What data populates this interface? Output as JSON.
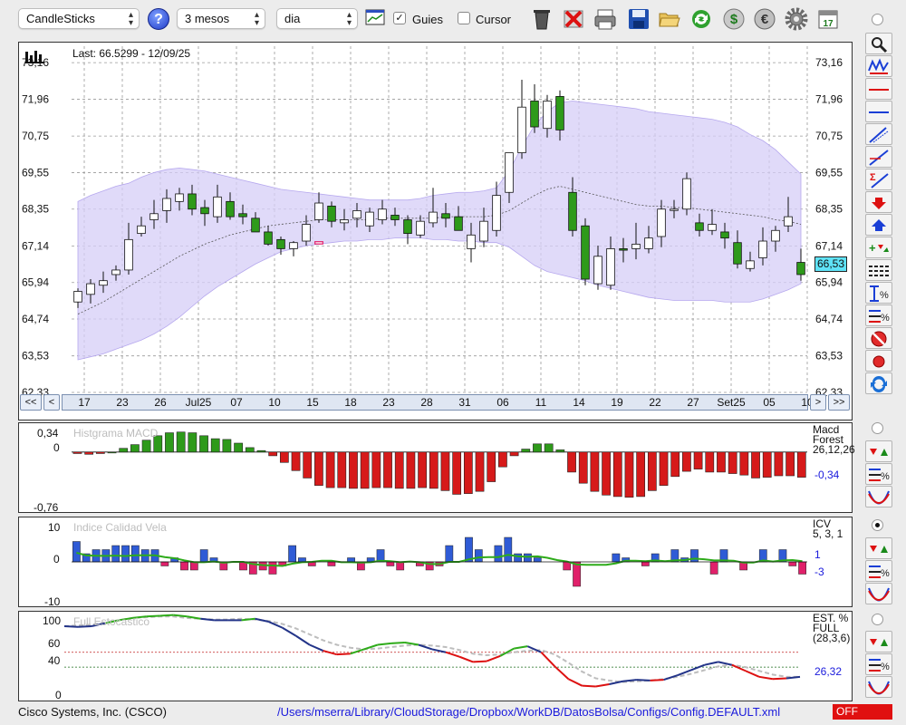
{
  "toolbar": {
    "chart_type": "CandleSticks",
    "period": "3 mesos",
    "interval": "dia",
    "guides_label": "Guies",
    "guides_checked": true,
    "cursor_label": "Cursor",
    "cursor_checked": false
  },
  "price_panel": {
    "last_label": "Last: 66.5299 - 12/09/25",
    "current_price": "66,53",
    "y_ticks": [
      "73,16",
      "71,96",
      "70,75",
      "69,55",
      "68,35",
      "67,14",
      "65,94",
      "64,74",
      "63,53",
      "62,33"
    ],
    "x_ticks": [
      "17",
      "23",
      "26",
      "Jul25",
      "07",
      "10",
      "15",
      "18",
      "23",
      "28",
      "31",
      "06",
      "11",
      "14",
      "19",
      "22",
      "27",
      "Set25",
      "05",
      "10"
    ],
    "nav": {
      "first": "<<",
      "prev": "<",
      "next": ">",
      "last": ">>"
    }
  },
  "macd_panel": {
    "title": "Histgrama MACD",
    "y_ticks": [
      "0,34",
      "0",
      "-0,76"
    ],
    "name": "Macd",
    "sub": "Forest",
    "params": "26,12,26",
    "value": "-0,34"
  },
  "icv_panel": {
    "title": "Indice Calidad Vela",
    "y_ticks": [
      "10",
      "0",
      "-10"
    ],
    "name": "ICV",
    "params": "5, 3, 1",
    "value1": "1",
    "value2": "-3"
  },
  "stoch_panel": {
    "title": "Full Estocastico",
    "y_ticks": [
      "100",
      "60",
      "40",
      "0"
    ],
    "name": "EST. %",
    "sub": "FULL",
    "params": "(28,3,6)",
    "value": "26,32"
  },
  "status": {
    "symbol": "Cisco Systems, Inc. (CSCO)",
    "config_path": "/Users/mserra/Library/CloudStorage/Dropbox/WorkDB/DatosBolsa/Configs/Config.DEFAULT.xml",
    "mode": "OFF"
  },
  "colors": {
    "up": "#2e9a1a",
    "down": "#d61a1a",
    "band": "#d6cdf7",
    "cyan": "#5fe3f7"
  },
  "chart_data": [
    {
      "type": "candlestick",
      "title": "",
      "ylim": [
        62.33,
        73.7
      ],
      "open": [
        65.3,
        65.55,
        65.85,
        66.2,
        66.35,
        67.55,
        68.0,
        68.3,
        68.6,
        68.85,
        68.4,
        68.1,
        68.6,
        68.2,
        68.05,
        67.6,
        67.35,
        67.05,
        67.3,
        68.0,
        68.45,
        67.9,
        68.05,
        67.8,
        68.0,
        68.15,
        68.0,
        67.5,
        67.9,
        68.2,
        68.1,
        67.05,
        67.3,
        67.65,
        68.9,
        70.2,
        71.9,
        71.0,
        72.05,
        68.9,
        67.8,
        65.9,
        65.85,
        67.05,
        67.05,
        67.05,
        67.45,
        68.35,
        68.35,
        67.9,
        67.65,
        67.6,
        67.25,
        66.4,
        66.75,
        67.3,
        67.8,
        66.6
      ],
      "close": [
        65.65,
        65.9,
        66.0,
        66.35,
        67.35,
        67.8,
        68.2,
        68.7,
        68.85,
        68.35,
        68.2,
        68.75,
        68.1,
        68.1,
        67.6,
        67.2,
        67.05,
        67.25,
        67.85,
        68.55,
        67.95,
        68.0,
        68.3,
        68.25,
        68.35,
        68.0,
        67.55,
        67.95,
        68.25,
        68.05,
        67.65,
        67.5,
        67.95,
        68.8,
        70.2,
        71.7,
        71.05,
        71.9,
        70.95,
        67.65,
        66.05,
        66.8,
        67.05,
        67.0,
        67.2,
        67.4,
        68.35,
        68.35,
        69.35,
        67.65,
        67.85,
        67.4,
        66.55,
        66.65,
        67.3,
        67.65,
        68.1,
        66.2
      ],
      "high": [
        65.75,
        66.05,
        66.3,
        66.5,
        67.9,
        68.1,
        68.65,
        69.0,
        69.05,
        69.15,
        68.65,
        69.15,
        68.9,
        68.5,
        68.25,
        67.8,
        67.45,
        67.3,
        68.15,
        68.9,
        68.6,
        68.35,
        68.55,
        68.4,
        68.65,
        68.4,
        68.15,
        68.15,
        69.05,
        68.55,
        68.45,
        67.9,
        68.4,
        69.25,
        69.95,
        72.6,
        72.45,
        72.1,
        72.25,
        69.4,
        68.05,
        67.15,
        67.45,
        67.4,
        67.9,
        67.8,
        68.65,
        68.65,
        69.55,
        68.2,
        68.35,
        67.9,
        67.65,
        66.95,
        67.75,
        67.8,
        68.75,
        67.05
      ],
      "low": [
        65.1,
        65.25,
        65.6,
        66.0,
        66.2,
        67.45,
        67.7,
        67.9,
        68.3,
        68.15,
        67.8,
        67.9,
        68.0,
        67.85,
        67.6,
        67.15,
        66.85,
        66.8,
        67.15,
        67.9,
        67.75,
        67.65,
        67.75,
        67.6,
        67.85,
        67.8,
        67.2,
        67.4,
        67.75,
        67.75,
        67.7,
        66.6,
        67.1,
        67.45,
        68.55,
        70.0,
        70.85,
        70.7,
        70.6,
        67.45,
        65.85,
        65.7,
        65.7,
        66.6,
        66.7,
        66.9,
        67.1,
        68.05,
        68.15,
        67.45,
        67.5,
        67.05,
        66.4,
        66.3,
        66.5,
        66.95,
        67.6,
        66.0
      ],
      "bollinger_upper": [
        68.6,
        68.8,
        68.95,
        69.1,
        69.2,
        69.4,
        69.55,
        69.65,
        69.7,
        69.65,
        69.6,
        69.5,
        69.4,
        69.3,
        69.2,
        69.1,
        69.0,
        68.95,
        68.9,
        68.85,
        68.8,
        68.75,
        68.7,
        68.65,
        68.65,
        68.65,
        68.65,
        68.7,
        68.8,
        68.85,
        68.9,
        68.9,
        68.95,
        69.05,
        69.6,
        70.4,
        71.1,
        71.55,
        71.85,
        71.9,
        71.85,
        71.8,
        71.75,
        71.7,
        71.65,
        71.55,
        71.5,
        71.45,
        71.4,
        71.35,
        71.3,
        71.2,
        71.05,
        70.8,
        70.6,
        70.3,
        69.9,
        69.5
      ],
      "bollinger_middle": [
        64.9,
        65.1,
        65.3,
        65.55,
        65.8,
        66.05,
        66.3,
        66.55,
        66.8,
        67.0,
        67.2,
        67.35,
        67.5,
        67.6,
        67.7,
        67.8,
        67.85,
        67.9,
        67.95,
        68.0,
        68.0,
        68.0,
        68.0,
        68.0,
        68.05,
        68.05,
        68.05,
        68.05,
        68.05,
        68.1,
        68.1,
        68.1,
        68.1,
        68.15,
        68.3,
        68.55,
        68.8,
        69.0,
        69.1,
        69.0,
        68.9,
        68.8,
        68.7,
        68.6,
        68.5,
        68.45,
        68.45,
        68.4,
        68.4,
        68.35,
        68.3,
        68.25,
        68.2,
        68.15,
        68.1,
        68.0,
        67.95,
        67.85
      ],
      "bollinger_lower": [
        63.4,
        63.5,
        63.6,
        63.75,
        63.9,
        64.05,
        64.25,
        64.5,
        64.8,
        65.15,
        65.5,
        65.8,
        66.05,
        66.3,
        66.55,
        66.75,
        66.95,
        67.05,
        67.15,
        67.2,
        67.25,
        67.3,
        67.3,
        67.35,
        67.35,
        67.4,
        67.4,
        67.4,
        67.35,
        67.35,
        67.3,
        67.3,
        67.25,
        67.25,
        67.1,
        66.8,
        66.5,
        66.3,
        66.2,
        66.1,
        66.0,
        65.85,
        65.75,
        65.65,
        65.55,
        65.45,
        65.4,
        65.35,
        65.35,
        65.35,
        65.35,
        65.3,
        65.3,
        65.3,
        65.4,
        65.55,
        65.7,
        65.9
      ]
    },
    {
      "type": "bar",
      "title": "Histgrama MACD",
      "ylim": [
        -0.76,
        0.34
      ],
      "values": [
        -0.02,
        -0.03,
        -0.02,
        0.0,
        0.05,
        0.1,
        0.16,
        0.22,
        0.26,
        0.27,
        0.26,
        0.22,
        0.18,
        0.17,
        0.12,
        0.06,
        0.02,
        -0.05,
        -0.14,
        -0.25,
        -0.35,
        -0.45,
        -0.48,
        -0.48,
        -0.49,
        -0.49,
        -0.48,
        -0.48,
        -0.49,
        -0.49,
        -0.48,
        -0.49,
        -0.52,
        -0.57,
        -0.56,
        -0.53,
        -0.4,
        -0.2,
        -0.05,
        0.04,
        0.11,
        0.11,
        0.03,
        -0.27,
        -0.42,
        -0.53,
        -0.58,
        -0.6,
        -0.61,
        -0.6,
        -0.52,
        -0.45,
        -0.33,
        -0.26,
        -0.23,
        -0.27,
        -0.27,
        -0.29,
        -0.31,
        -0.35,
        -0.34,
        -0.32,
        -0.32,
        -0.34
      ]
    },
    {
      "type": "bar",
      "title": "Indice Calidad Vela",
      "ylim": [
        -10,
        10
      ],
      "values": [
        5,
        2,
        3,
        3,
        4,
        4,
        4,
        3,
        3,
        -1,
        1,
        -2,
        -2,
        3,
        1,
        -2,
        0,
        -2,
        -3,
        -2,
        -3,
        -1,
        4,
        1,
        -1,
        0,
        -1,
        0,
        1,
        -2,
        1,
        3,
        -1,
        -2,
        0,
        -1,
        -2,
        -1,
        4,
        0,
        6,
        3,
        0,
        4,
        6,
        2,
        2,
        1,
        0,
        0,
        -2,
        -6,
        0,
        0,
        0,
        2,
        1,
        0,
        -1,
        2,
        0,
        3,
        1,
        3,
        0,
        -3,
        3,
        0,
        -2,
        0,
        3,
        0,
        3,
        -1,
        -3
      ]
    },
    {
      "type": "line",
      "title": "Full Estocastico",
      "ylim": [
        0,
        100
      ],
      "series": [
        {
          "values": [
            95,
            94,
            95,
            99,
            103,
            106,
            108,
            109,
            110,
            108,
            105,
            103,
            103,
            103,
            105,
            101,
            93,
            82,
            70,
            62,
            57,
            58,
            64,
            70,
            72,
            73,
            70,
            64,
            60,
            54,
            47,
            48,
            55,
            65,
            68,
            60,
            41,
            24,
            15,
            14,
            17,
            21,
            23,
            22,
            23,
            29,
            36,
            43,
            47,
            43,
            35,
            27,
            24,
            25,
            27
          ]
        },
        {
          "values": [
            95,
            96,
            97,
            100,
            103,
            106,
            107,
            108,
            108,
            106,
            105,
            104,
            104,
            105,
            104,
            102,
            98,
            92,
            84,
            76,
            70,
            66,
            64,
            65,
            67,
            69,
            70,
            69,
            67,
            63,
            58,
            56,
            57,
            60,
            62,
            63,
            57,
            46,
            34,
            25,
            22,
            20,
            21,
            22,
            24,
            27,
            31,
            36,
            41,
            43,
            40,
            35,
            30,
            27,
            27
          ]
        }
      ]
    }
  ]
}
